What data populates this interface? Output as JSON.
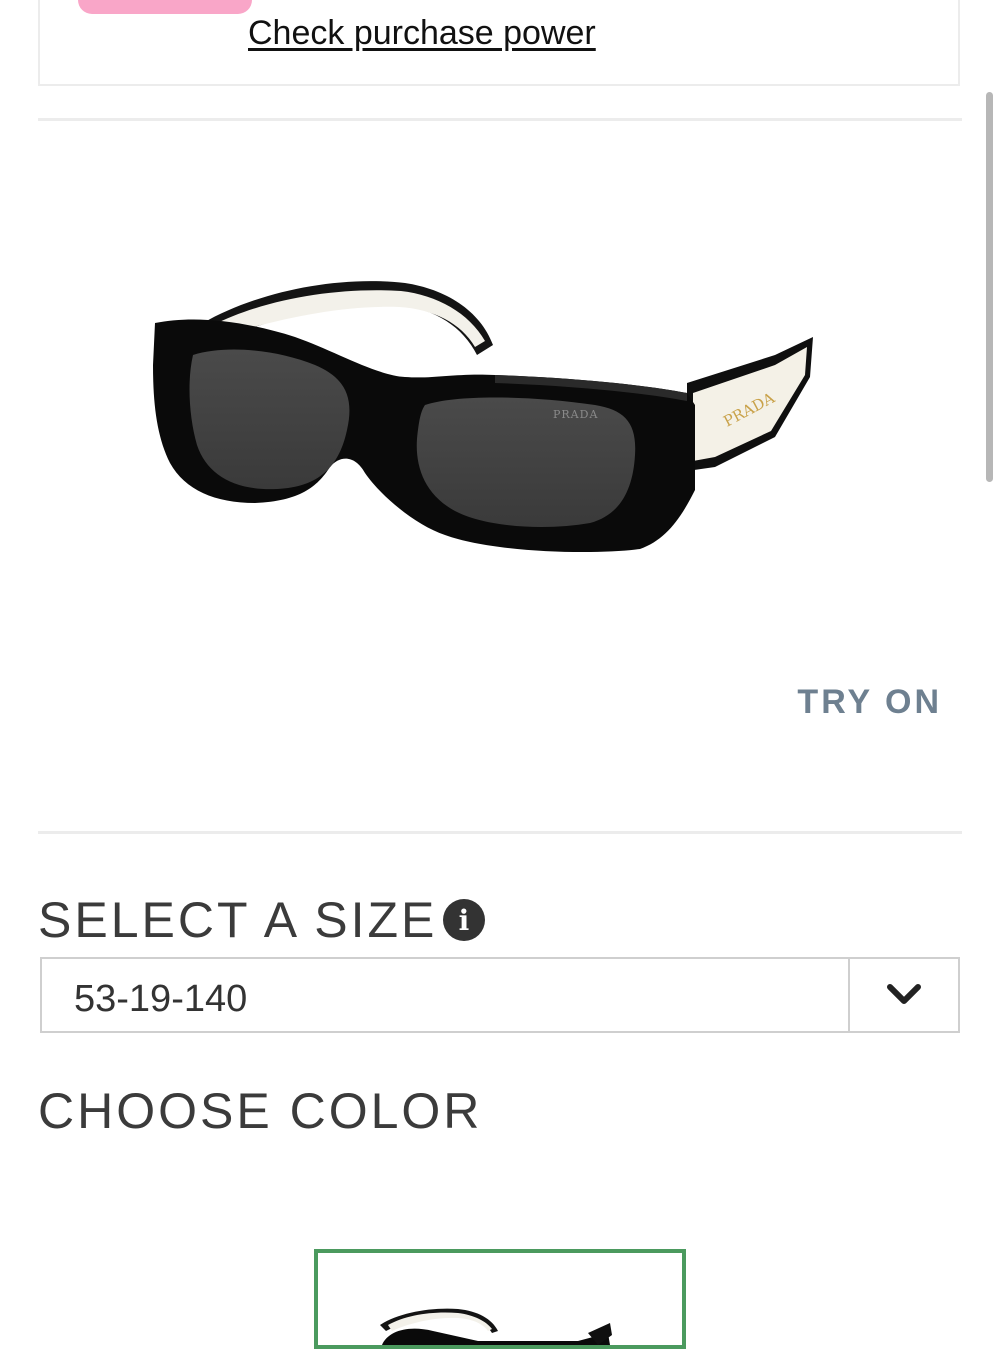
{
  "financing": {
    "link_label": "Check purchase power"
  },
  "product": {
    "image_icon": "sunglasses-image",
    "brand_mark": "PRADA",
    "try_on_label": "TRY ON"
  },
  "size": {
    "heading": "SELECT A SIZE",
    "info_icon": "info-icon",
    "info_glyph": "i",
    "selected": "53-19-140",
    "dropdown_icon": "chevron-down-icon"
  },
  "color": {
    "heading": "CHOOSE COLOR",
    "swatch_icon": "sunglasses-thumbnail",
    "accent": "#4b9a5e"
  },
  "colors": {
    "pill": "#f9a6c8",
    "try_on": "#6e8090",
    "heading": "#3b3b3b"
  }
}
